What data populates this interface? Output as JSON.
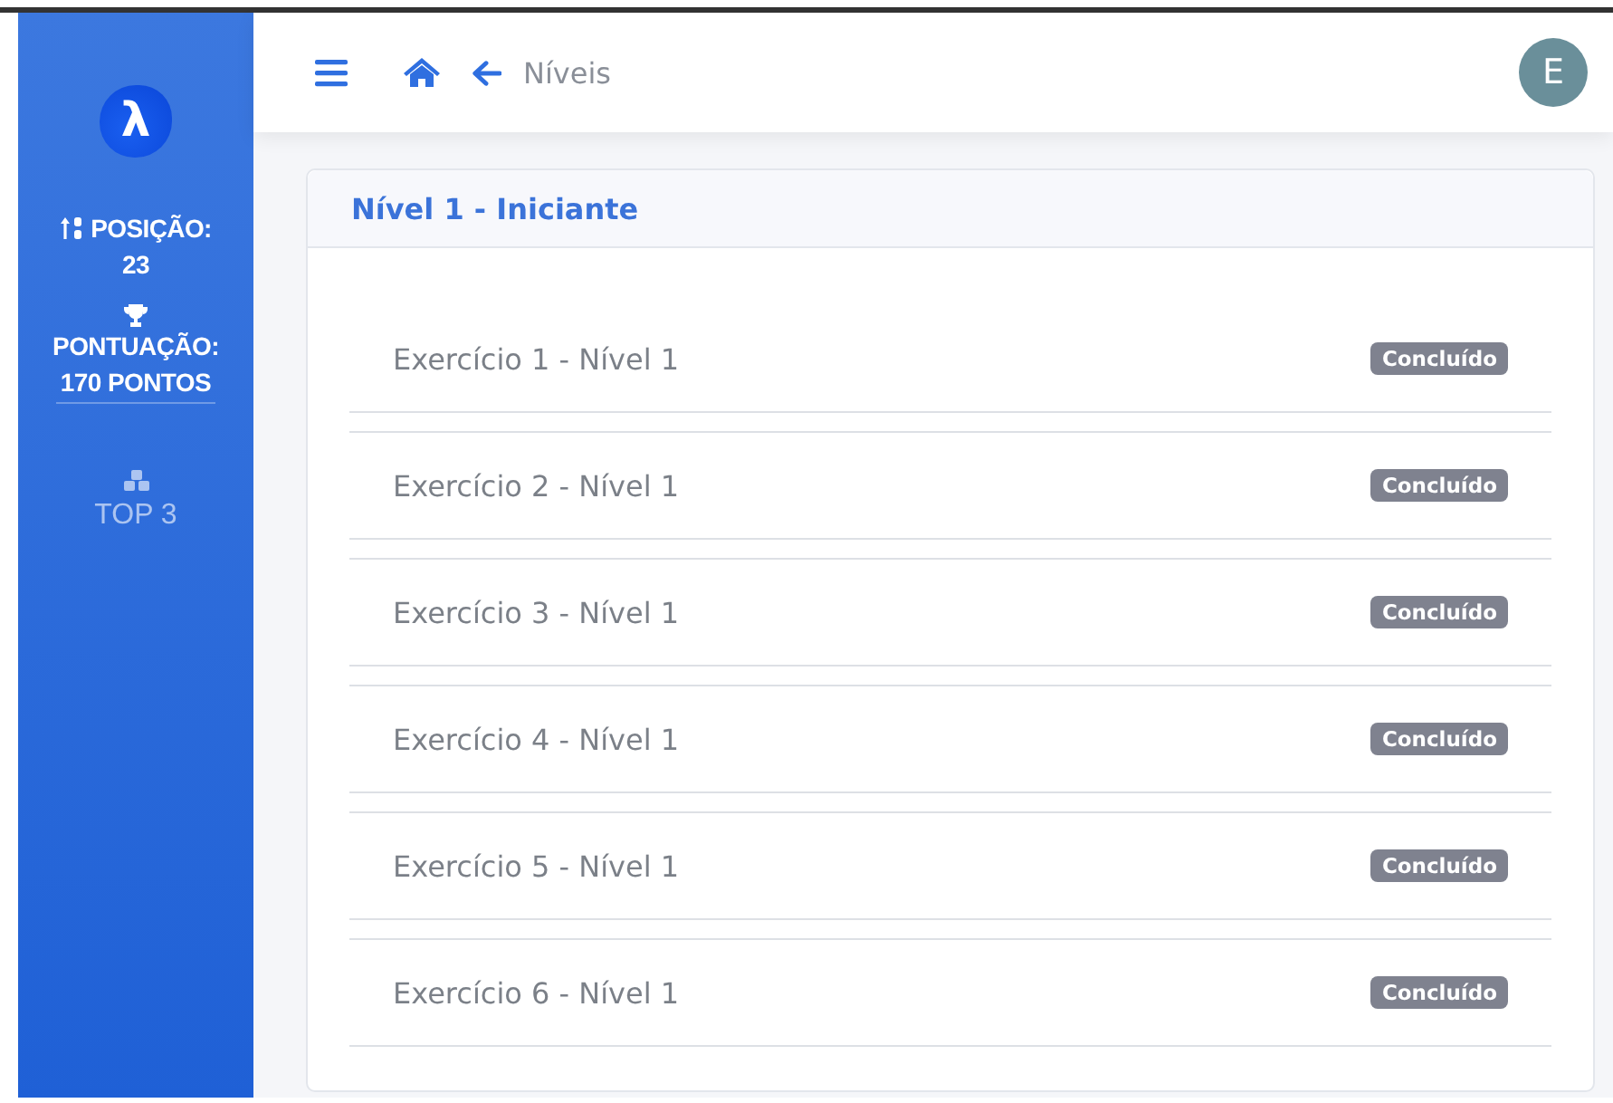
{
  "sidebar": {
    "logo": "λ",
    "position": {
      "label": "POSIÇÃO:",
      "value": "23"
    },
    "score": {
      "label": "PONTUAÇÃO:",
      "value": "170 PONTOS"
    },
    "items": [
      {
        "label": "TOP 3",
        "selected": false
      }
    ]
  },
  "header": {
    "title": "Níveis",
    "avatar": "E"
  },
  "card": {
    "title": "Nível 1 - Iniciante",
    "exercises": [
      {
        "name": "Exercício 1 - Nível 1",
        "status": "Concluído"
      },
      {
        "name": "Exercício 2 - Nível 1",
        "status": "Concluído"
      },
      {
        "name": "Exercício 3 - Nível 1",
        "status": "Concluído"
      },
      {
        "name": "Exercício 4 - Nível 1",
        "status": "Concluído"
      },
      {
        "name": "Exercício 5 - Nível 1",
        "status": "Concluído"
      },
      {
        "name": "Exercício 6 - Nível 1",
        "status": "Concluído"
      }
    ]
  }
}
